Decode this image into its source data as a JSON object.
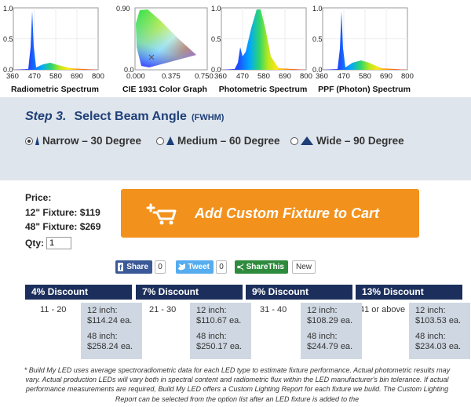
{
  "spectra": [
    {
      "title": "Radiometric Spectrum",
      "y_ticks": [
        "1.0",
        "0.5",
        "0.0"
      ],
      "x_ticks": [
        "360",
        "470",
        "580",
        "690",
        "800"
      ]
    },
    {
      "title": "CIE 1931 Color Graph",
      "y_ticks": [
        "0.90",
        "0.0"
      ],
      "x_ticks": [
        "0.000",
        "0.375",
        "0.750"
      ]
    },
    {
      "title": "Photometric Spectrum",
      "y_ticks": [
        "1.0",
        "0.5",
        "0.0"
      ],
      "x_ticks": [
        "360",
        "470",
        "580",
        "690",
        "800"
      ]
    },
    {
      "title": "PPF (Photon) Spectrum",
      "y_ticks": [
        "1.0",
        "0.5",
        "0.0"
      ],
      "x_ticks": [
        "360",
        "470",
        "580",
        "690",
        "800"
      ]
    }
  ],
  "step": {
    "number": "Step 3.",
    "title": "Select Beam Angle",
    "suffix": "(FWHM)"
  },
  "beam_options": [
    {
      "label": "Narrow – 30 Degree",
      "selected": true
    },
    {
      "label": "Medium – 60 Degree",
      "selected": false
    },
    {
      "label": "Wide – 90 Degree",
      "selected": false
    }
  ],
  "price": {
    "heading": "Price:",
    "line1": "12\" Fixture: $119",
    "line2": "48\" Fixture: $269"
  },
  "cart_button": "Add Custom Fixture to Cart",
  "qty": {
    "label": "Qty:",
    "value": "1"
  },
  "social": {
    "share": "Share",
    "share_count": "0",
    "tweet": "Tweet",
    "tweet_count": "0",
    "sharethis": "ShareThis",
    "new": "New"
  },
  "discounts": [
    {
      "title": "4% Discount",
      "range": "11 - 20",
      "inch12_label": "12 inch:",
      "inch12": "$114.24 ea.",
      "inch48_label": "48 inch:",
      "inch48": "$258.24 ea."
    },
    {
      "title": "7% Discount",
      "range": "21 - 30",
      "inch12_label": "12 inch:",
      "inch12": "$110.67 ea.",
      "inch48_label": "48 inch:",
      "inch48": "$250.17 ea."
    },
    {
      "title": "9% Discount",
      "range": "31 - 40",
      "inch12_label": "12 inch:",
      "inch12": "$108.29 ea.",
      "inch48_label": "48 inch:",
      "inch48": "$244.79 ea."
    },
    {
      "title": "13% Discount",
      "range": "41 or above",
      "inch12_label": "12 inch:",
      "inch12": "$103.53 ea.",
      "inch48_label": "48 inch:",
      "inch48": "$234.03 ea."
    }
  ],
  "footnote": "* Build My LED uses average spectroradiometric data for each LED type to estimate fixture performance. Actual photometric results may vary. Actual production LEDs will vary both in spectral content and radiometric flux within the LED manufacturer's bin tolerance. If actual performance measurements are required, Build My LED offers a Custom Lighting Report for each fixture we build. The Custom Lighting Report can be selected from the option list after an LED fixture is added to the",
  "colors": {
    "band": "#dfe5ec",
    "heading": "#1e3f78",
    "cart": "#f2921d",
    "table_head": "#1c2f5c",
    "cell": "#cfd8e2"
  }
}
